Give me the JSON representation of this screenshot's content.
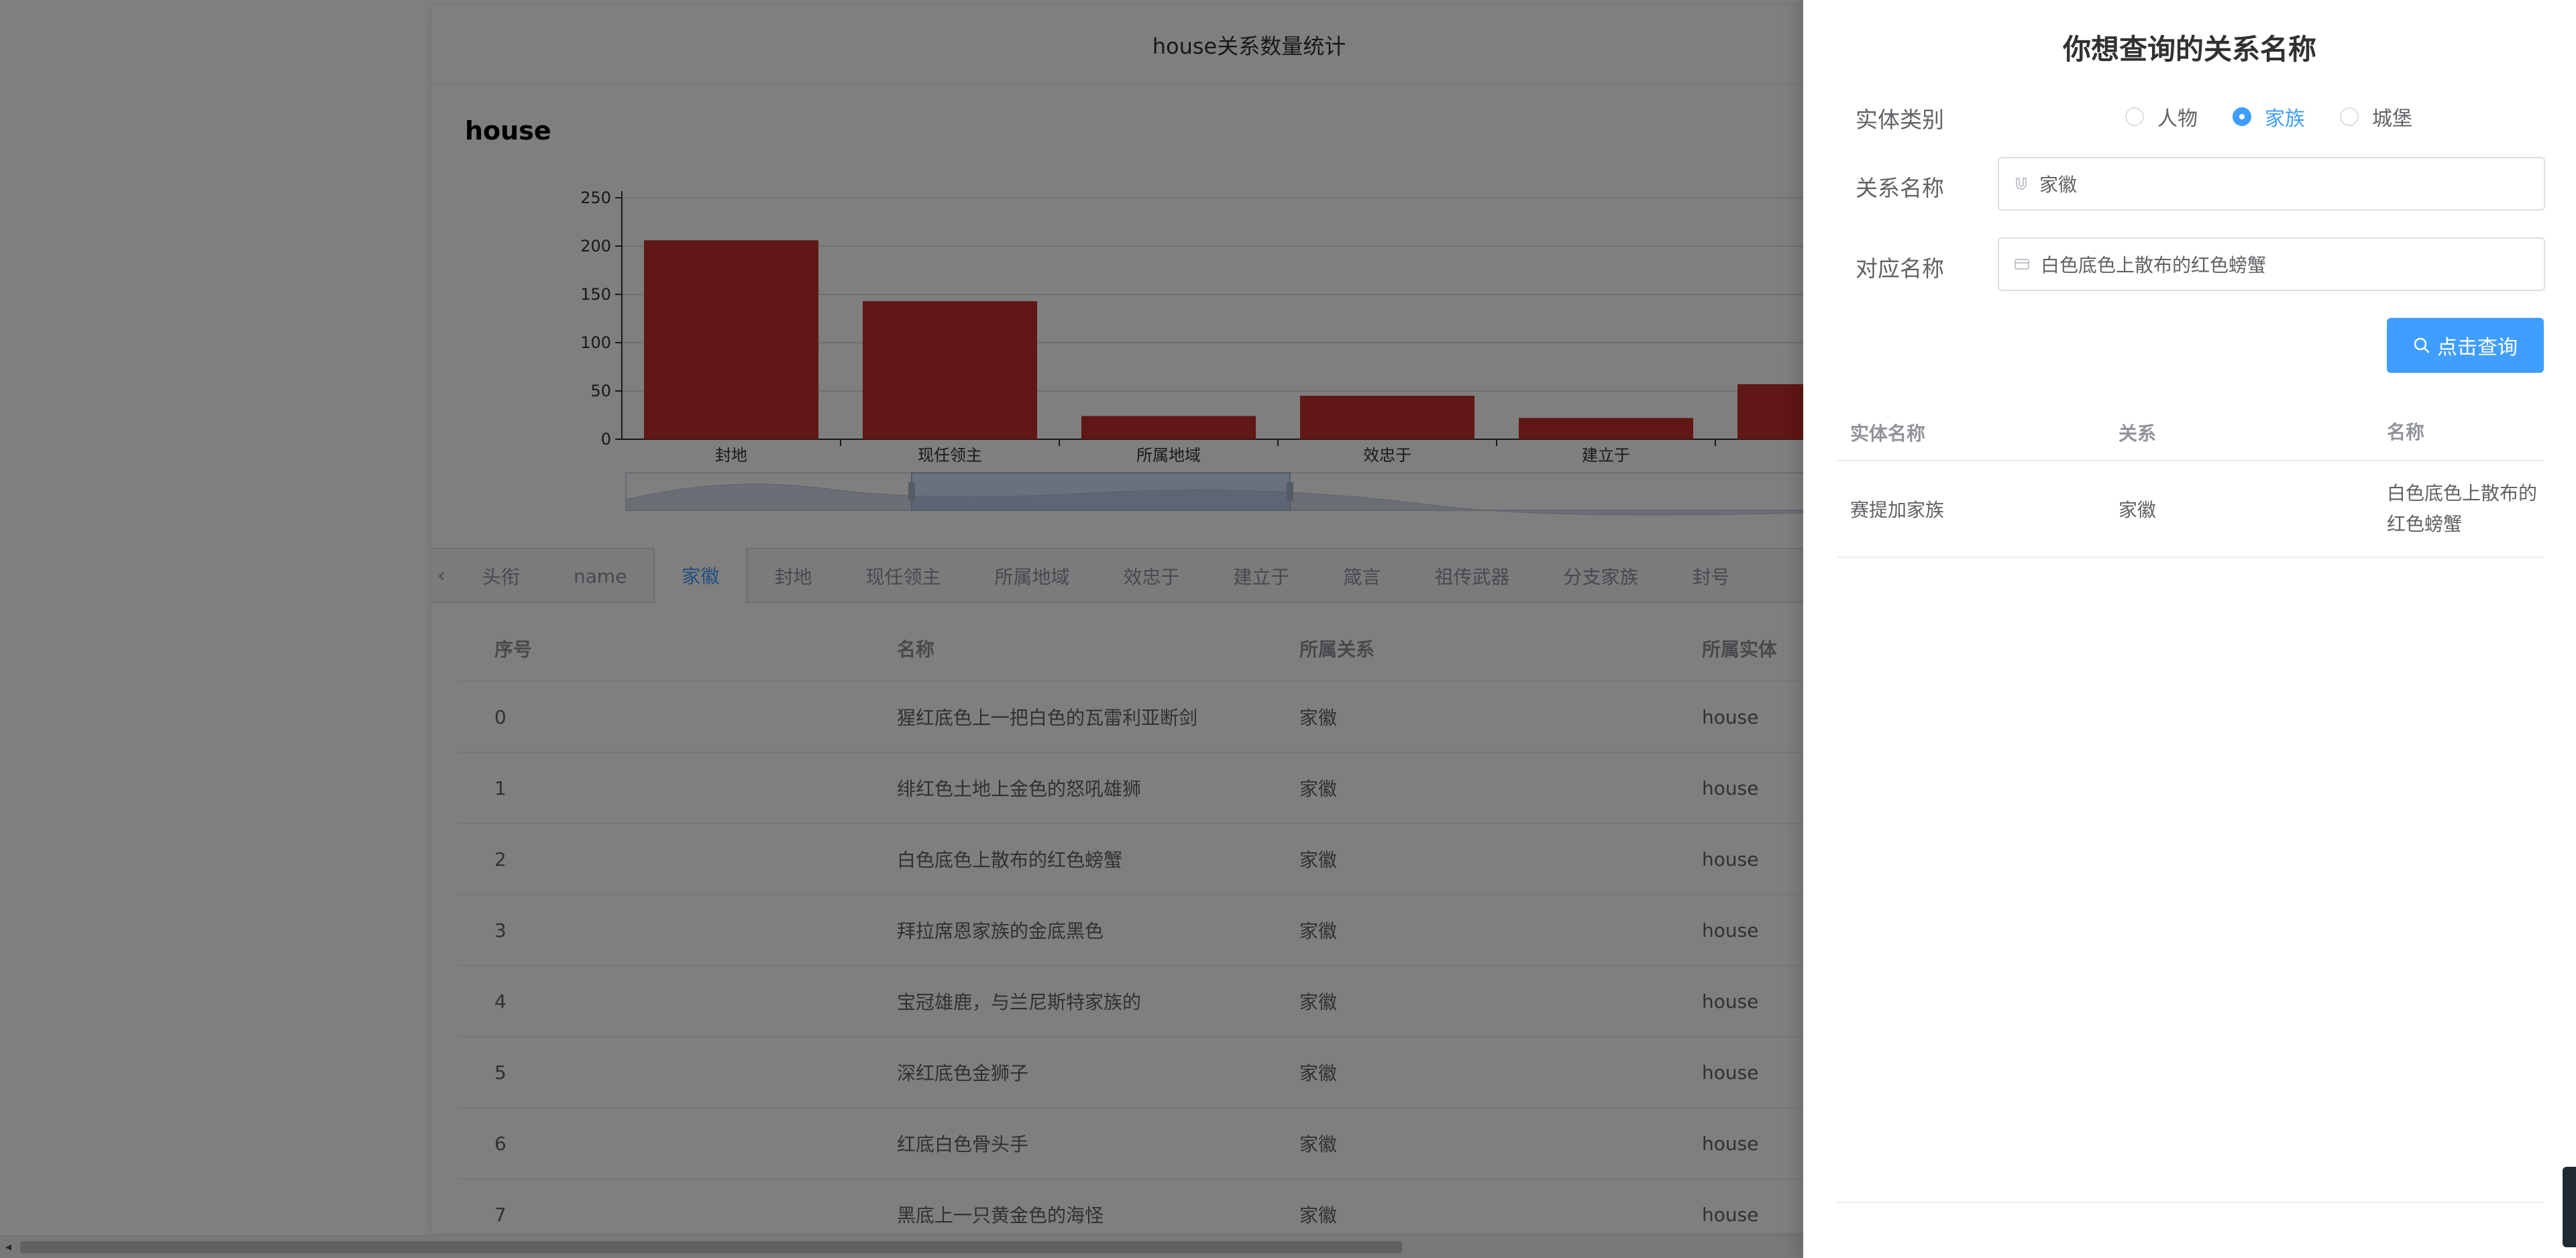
{
  "card": {
    "title": "house关系数量统计"
  },
  "chart_data": {
    "type": "bar",
    "heading": "house",
    "categories": [
      "封地",
      "现任领主",
      "所属地域",
      "效忠于",
      "建立于",
      ""
    ],
    "values": [
      206,
      143,
      24,
      45,
      22,
      57
    ],
    "yticks": [
      "0",
      "50",
      "100",
      "150",
      "200",
      "250"
    ],
    "ylim": [
      0,
      250
    ],
    "bar_color": "#c12e2b",
    "datazoom": {
      "start": 0.33,
      "end": 0.77
    }
  },
  "tabs": {
    "items": [
      "头衔",
      "name",
      "家徽",
      "封地",
      "现任领主",
      "所属地域",
      "效忠于",
      "建立于",
      "箴言",
      "祖传武器",
      "分支家族",
      "封号"
    ],
    "active_index": 2,
    "prev_glyph": "‹"
  },
  "table": {
    "headers": [
      "序号",
      "名称",
      "所属关系",
      "所属实体"
    ],
    "rows": [
      [
        "0",
        "猩红底色上一把白色的瓦雷利亚断剑",
        "家徽",
        "house"
      ],
      [
        "1",
        "绯红色土地上金色的怒吼雄狮",
        "家徽",
        "house"
      ],
      [
        "2",
        "白色底色上散布的红色螃蟹",
        "家徽",
        "house"
      ],
      [
        "3",
        "拜拉席恩家族的金底黑色",
        "家徽",
        "house"
      ],
      [
        "4",
        "宝冠雄鹿，与兰尼斯特家族的",
        "家徽",
        "house"
      ],
      [
        "5",
        "深红底色金狮子",
        "家徽",
        "house"
      ],
      [
        "6",
        "红底白色骨头手",
        "家徽",
        "house"
      ],
      [
        "7",
        "黑底上一只黄金色的海怪",
        "家徽",
        "house"
      ]
    ]
  },
  "drawer": {
    "title": "你想查询的关系名称",
    "entity_label": "实体类别",
    "radios": [
      "人物",
      "家族",
      "城堡"
    ],
    "radio_checked": 1,
    "relation_label": "关系名称",
    "relation_value": "家徽",
    "target_label": "对应名称",
    "target_value": "白色底色上散布的红色螃蟹",
    "query_button": "点击查询",
    "result_headers": [
      "实体名称",
      "关系",
      "名称"
    ],
    "result_row": [
      "赛提加家族",
      "家徽",
      "白色底色上散布的红色螃蟹"
    ]
  },
  "icons": {
    "search": "search-icon",
    "magnet": "magnet-icon",
    "card": "card-icon",
    "scroll_left": "◂"
  },
  "colors": {
    "accent": "#409eff",
    "bar": "#c12e2b"
  }
}
